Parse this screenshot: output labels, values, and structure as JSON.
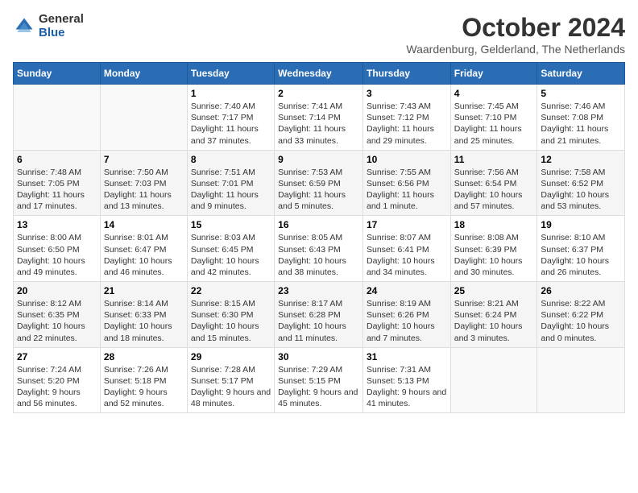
{
  "header": {
    "logo_general": "General",
    "logo_blue": "Blue",
    "title": "October 2024",
    "subtitle": "Waardenburg, Gelderland, The Netherlands"
  },
  "weekdays": [
    "Sunday",
    "Monday",
    "Tuesday",
    "Wednesday",
    "Thursday",
    "Friday",
    "Saturday"
  ],
  "weeks": [
    [
      {
        "day": "",
        "detail": ""
      },
      {
        "day": "",
        "detail": ""
      },
      {
        "day": "1",
        "detail": "Sunrise: 7:40 AM\nSunset: 7:17 PM\nDaylight: 11 hours and 37 minutes."
      },
      {
        "day": "2",
        "detail": "Sunrise: 7:41 AM\nSunset: 7:14 PM\nDaylight: 11 hours and 33 minutes."
      },
      {
        "day": "3",
        "detail": "Sunrise: 7:43 AM\nSunset: 7:12 PM\nDaylight: 11 hours and 29 minutes."
      },
      {
        "day": "4",
        "detail": "Sunrise: 7:45 AM\nSunset: 7:10 PM\nDaylight: 11 hours and 25 minutes."
      },
      {
        "day": "5",
        "detail": "Sunrise: 7:46 AM\nSunset: 7:08 PM\nDaylight: 11 hours and 21 minutes."
      }
    ],
    [
      {
        "day": "6",
        "detail": "Sunrise: 7:48 AM\nSunset: 7:05 PM\nDaylight: 11 hours and 17 minutes."
      },
      {
        "day": "7",
        "detail": "Sunrise: 7:50 AM\nSunset: 7:03 PM\nDaylight: 11 hours and 13 minutes."
      },
      {
        "day": "8",
        "detail": "Sunrise: 7:51 AM\nSunset: 7:01 PM\nDaylight: 11 hours and 9 minutes."
      },
      {
        "day": "9",
        "detail": "Sunrise: 7:53 AM\nSunset: 6:59 PM\nDaylight: 11 hours and 5 minutes."
      },
      {
        "day": "10",
        "detail": "Sunrise: 7:55 AM\nSunset: 6:56 PM\nDaylight: 11 hours and 1 minute."
      },
      {
        "day": "11",
        "detail": "Sunrise: 7:56 AM\nSunset: 6:54 PM\nDaylight: 10 hours and 57 minutes."
      },
      {
        "day": "12",
        "detail": "Sunrise: 7:58 AM\nSunset: 6:52 PM\nDaylight: 10 hours and 53 minutes."
      }
    ],
    [
      {
        "day": "13",
        "detail": "Sunrise: 8:00 AM\nSunset: 6:50 PM\nDaylight: 10 hours and 49 minutes."
      },
      {
        "day": "14",
        "detail": "Sunrise: 8:01 AM\nSunset: 6:47 PM\nDaylight: 10 hours and 46 minutes."
      },
      {
        "day": "15",
        "detail": "Sunrise: 8:03 AM\nSunset: 6:45 PM\nDaylight: 10 hours and 42 minutes."
      },
      {
        "day": "16",
        "detail": "Sunrise: 8:05 AM\nSunset: 6:43 PM\nDaylight: 10 hours and 38 minutes."
      },
      {
        "day": "17",
        "detail": "Sunrise: 8:07 AM\nSunset: 6:41 PM\nDaylight: 10 hours and 34 minutes."
      },
      {
        "day": "18",
        "detail": "Sunrise: 8:08 AM\nSunset: 6:39 PM\nDaylight: 10 hours and 30 minutes."
      },
      {
        "day": "19",
        "detail": "Sunrise: 8:10 AM\nSunset: 6:37 PM\nDaylight: 10 hours and 26 minutes."
      }
    ],
    [
      {
        "day": "20",
        "detail": "Sunrise: 8:12 AM\nSunset: 6:35 PM\nDaylight: 10 hours and 22 minutes."
      },
      {
        "day": "21",
        "detail": "Sunrise: 8:14 AM\nSunset: 6:33 PM\nDaylight: 10 hours and 18 minutes."
      },
      {
        "day": "22",
        "detail": "Sunrise: 8:15 AM\nSunset: 6:30 PM\nDaylight: 10 hours and 15 minutes."
      },
      {
        "day": "23",
        "detail": "Sunrise: 8:17 AM\nSunset: 6:28 PM\nDaylight: 10 hours and 11 minutes."
      },
      {
        "day": "24",
        "detail": "Sunrise: 8:19 AM\nSunset: 6:26 PM\nDaylight: 10 hours and 7 minutes."
      },
      {
        "day": "25",
        "detail": "Sunrise: 8:21 AM\nSunset: 6:24 PM\nDaylight: 10 hours and 3 minutes."
      },
      {
        "day": "26",
        "detail": "Sunrise: 8:22 AM\nSunset: 6:22 PM\nDaylight: 10 hours and 0 minutes."
      }
    ],
    [
      {
        "day": "27",
        "detail": "Sunrise: 7:24 AM\nSunset: 5:20 PM\nDaylight: 9 hours and 56 minutes."
      },
      {
        "day": "28",
        "detail": "Sunrise: 7:26 AM\nSunset: 5:18 PM\nDaylight: 9 hours and 52 minutes."
      },
      {
        "day": "29",
        "detail": "Sunrise: 7:28 AM\nSunset: 5:17 PM\nDaylight: 9 hours and 48 minutes."
      },
      {
        "day": "30",
        "detail": "Sunrise: 7:29 AM\nSunset: 5:15 PM\nDaylight: 9 hours and 45 minutes."
      },
      {
        "day": "31",
        "detail": "Sunrise: 7:31 AM\nSunset: 5:13 PM\nDaylight: 9 hours and 41 minutes."
      },
      {
        "day": "",
        "detail": ""
      },
      {
        "day": "",
        "detail": ""
      }
    ]
  ]
}
